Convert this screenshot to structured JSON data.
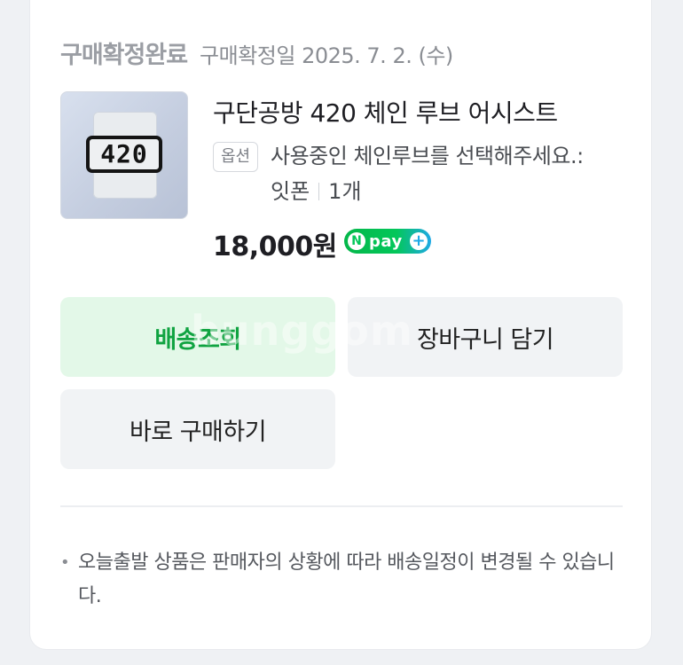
{
  "order": {
    "status": "구매확정완료",
    "confirm_date": "구매확정일 2025. 7. 2. (수)"
  },
  "product": {
    "image_text": "420",
    "name": "구단공방 420 체인 루브 어시스트",
    "option_badge": "옵션",
    "option_text": "사용중인 체인루브를 선택해주세요.:",
    "option_value": "잇폰",
    "quantity": "1개",
    "price": "18,000원",
    "pay_badge": {
      "n": "N",
      "label": "pay",
      "plus": "+"
    }
  },
  "actions": {
    "track_delivery": "배송조회",
    "add_to_cart": "장바구니 담기",
    "buy_now": "바로 구매하기"
  },
  "notice": {
    "bullet": "•",
    "text": "오늘출발 상품은 판매자의 상황에 따라 배송일정이 변경될 수 있습니다."
  },
  "watermark": "bunggom",
  "colors": {
    "accent_green": "#10a341",
    "green_button_bg": "#e3f8e8",
    "npay_green": "#03c75a"
  }
}
